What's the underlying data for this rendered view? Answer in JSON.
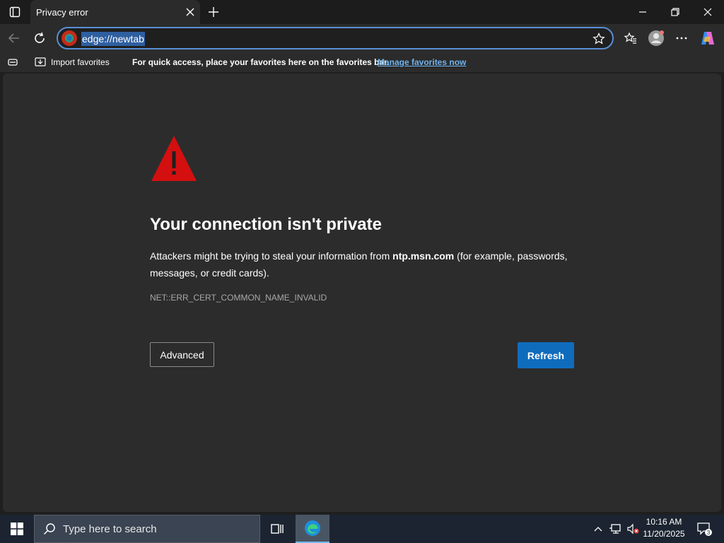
{
  "browser": {
    "tab_title": "Privacy error",
    "url": "edge://newtab"
  },
  "favorites_bar": {
    "import_label": "Import favorites",
    "message": "For quick access, place your favorites here on the favorites bar.",
    "manage_link": "Manage favorites now"
  },
  "error_page": {
    "heading": "Your connection isn't private",
    "description_prefix": "Attackers might be trying to steal your information from ",
    "host": "ntp.msn.com",
    "description_suffix": " (for example, passwords, messages, or credit cards).",
    "error_code": "NET::ERR_CERT_COMMON_NAME_INVALID",
    "advanced_label": "Advanced",
    "refresh_label": "Refresh"
  },
  "taskbar": {
    "search_placeholder": "Type here to search",
    "time": "10:16 AM",
    "date": "11/20/2025",
    "notification_count": "3"
  },
  "colors": {
    "accent_blue": "#0f6cbd",
    "link_blue": "#6fb3ef",
    "warning_red": "#d40f0f"
  }
}
